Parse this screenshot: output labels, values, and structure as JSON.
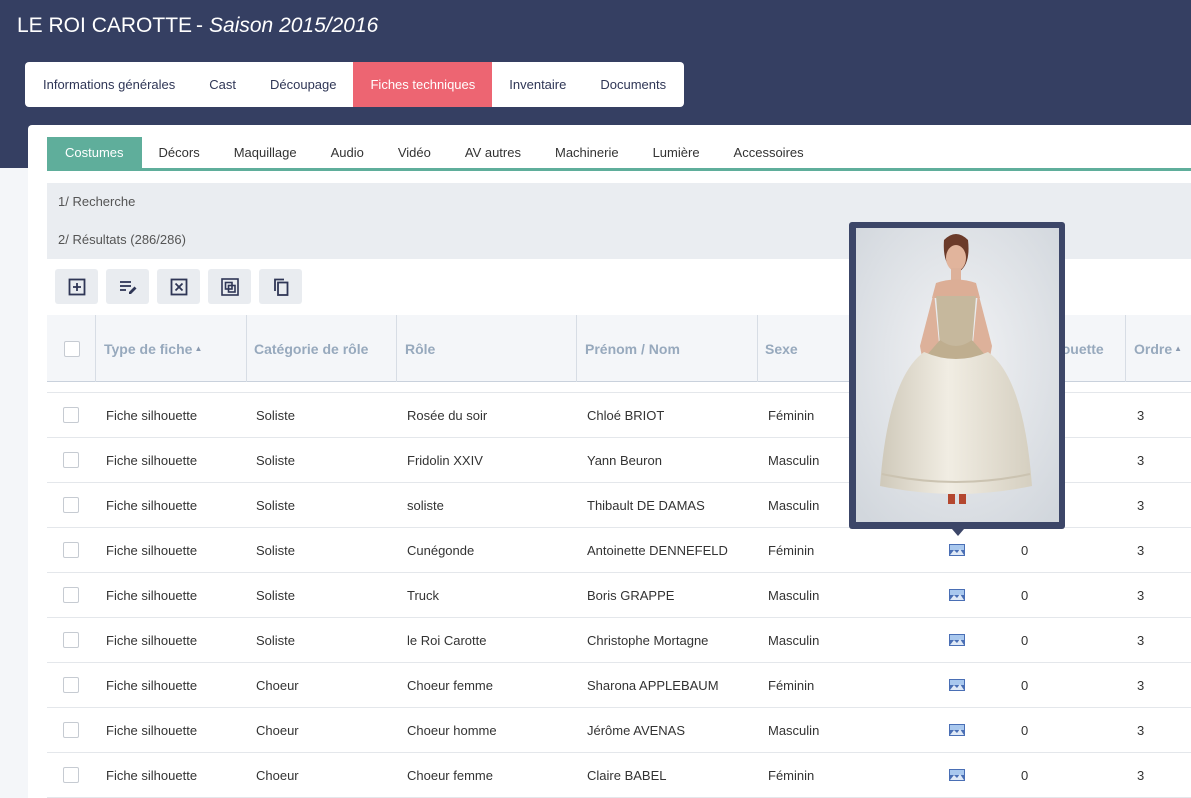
{
  "app": {
    "title": "LE ROI CAROTTE",
    "separator": "-",
    "season": "Saison 2015/2016"
  },
  "main_tabs": [
    {
      "label": "Informations générales",
      "active": false
    },
    {
      "label": "Cast",
      "active": false
    },
    {
      "label": "Découpage",
      "active": false
    },
    {
      "label": "Fiches techniques",
      "active": true
    },
    {
      "label": "Inventaire",
      "active": false
    },
    {
      "label": "Documents",
      "active": false
    }
  ],
  "sub_tabs": [
    {
      "label": "Costumes",
      "active": true
    },
    {
      "label": "Décors",
      "active": false
    },
    {
      "label": "Maquillage",
      "active": false
    },
    {
      "label": "Audio",
      "active": false
    },
    {
      "label": "Vidéo",
      "active": false
    },
    {
      "label": "AV autres",
      "active": false
    },
    {
      "label": "Machinerie",
      "active": false
    },
    {
      "label": "Lumière",
      "active": false
    },
    {
      "label": "Accessoires",
      "active": false
    }
  ],
  "sections": {
    "search": "1/ Recherche",
    "results": "2/ Résultats (286/286)"
  },
  "toolbar": [
    {
      "icon": "add-icon"
    },
    {
      "icon": "edit-icon"
    },
    {
      "icon": "delete-icon"
    },
    {
      "icon": "duplicate-icon"
    },
    {
      "icon": "copy-icon"
    }
  ],
  "table": {
    "columns": {
      "type": "Type de fiche",
      "category": "Catégorie de rôle",
      "role": "Rôle",
      "name": "Prénom / Nom",
      "sex": "Sexe",
      "silhouette": "N° silhouette",
      "order": "Ordre"
    },
    "sort_indicator": "▲",
    "rows": [
      {
        "type": "Fiche silhouette",
        "category": "Soliste",
        "role": "Rosée du soir",
        "name": "Chloé BRIOT",
        "sex": "Féminin",
        "silhouette": "0",
        "order": "3",
        "image_visible": false
      },
      {
        "type": "Fiche silhouette",
        "category": "Soliste",
        "role": "Fridolin XXIV",
        "name": "Yann Beuron",
        "sex": "Masculin",
        "silhouette": "0",
        "order": "3",
        "image_visible": false
      },
      {
        "type": "Fiche silhouette",
        "category": "Soliste",
        "role": "soliste",
        "name": "Thibault DE DAMAS",
        "sex": "Masculin",
        "silhouette": "0",
        "order": "3",
        "image_visible": false
      },
      {
        "type": "Fiche silhouette",
        "category": "Soliste",
        "role": "Cunégonde",
        "name": "Antoinette DENNEFELD",
        "sex": "Féminin",
        "silhouette": "0",
        "order": "3",
        "image_visible": true
      },
      {
        "type": "Fiche silhouette",
        "category": "Soliste",
        "role": "Truck",
        "name": "Boris GRAPPE",
        "sex": "Masculin",
        "silhouette": "0",
        "order": "3",
        "image_visible": true
      },
      {
        "type": "Fiche silhouette",
        "category": "Soliste",
        "role": "le Roi Carotte",
        "name": "Christophe Mortagne",
        "sex": "Masculin",
        "silhouette": "0",
        "order": "3",
        "image_visible": true
      },
      {
        "type": "Fiche silhouette",
        "category": "Choeur",
        "role": "Choeur femme",
        "name": "Sharona APPLEBAUM",
        "sex": "Féminin",
        "silhouette": "0",
        "order": "3",
        "image_visible": true
      },
      {
        "type": "Fiche silhouette",
        "category": "Choeur",
        "role": "Choeur homme",
        "name": "Jérôme AVENAS",
        "sex": "Masculin",
        "silhouette": "0",
        "order": "3",
        "image_visible": true
      },
      {
        "type": "Fiche silhouette",
        "category": "Choeur",
        "role": "Choeur femme",
        "name": "Claire BABEL",
        "sex": "Féminin",
        "silhouette": "0",
        "order": "3",
        "image_visible": true
      }
    ]
  },
  "colors": {
    "header_bg": "#353f62",
    "active_main_tab": "#ed6572",
    "active_sub_tab": "#5fae9b",
    "popup_frame": "#3c4668"
  }
}
